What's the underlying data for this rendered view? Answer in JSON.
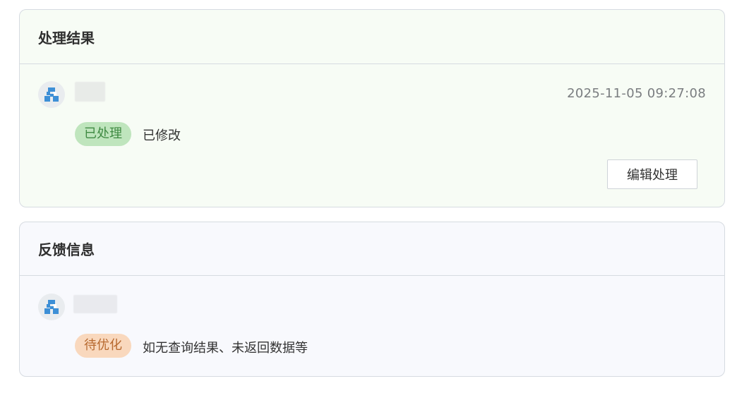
{
  "result_card": {
    "title": "处理结果",
    "timestamp": "2025-11-05 09:27:08",
    "status_tag": "已处理",
    "description": "已修改",
    "edit_button_label": "编辑处理",
    "avatar_icon": "user-avatar-icon"
  },
  "feedback_card": {
    "title": "反馈信息",
    "status_tag": "待优化",
    "description": "如无查询结果、未返回数据等",
    "avatar_icon": "user-avatar-icon"
  },
  "colors": {
    "result_bg": "#f7fcf5",
    "feedback_bg": "#f8f9fd",
    "done_tag_bg": "#bfe5bd",
    "done_tag_text": "#3f8a42",
    "pending_tag_bg": "#f9d8bd",
    "pending_tag_text": "#b86a30",
    "avatar_blue": "#3d8fd6"
  }
}
